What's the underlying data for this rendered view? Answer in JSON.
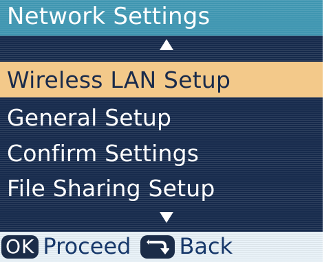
{
  "title": "Network Settings",
  "menu": {
    "items": [
      {
        "label": "Wireless LAN Setup",
        "selected": true
      },
      {
        "label": "General Setup",
        "selected": false
      },
      {
        "label": "Confirm Settings",
        "selected": false
      },
      {
        "label": "File Sharing Setup",
        "selected": false
      }
    ],
    "scroll_up_icon": "triangle-up-icon",
    "scroll_down_icon": "triangle-down-icon"
  },
  "footer": {
    "ok_badge": "OK",
    "proceed_label": "Proceed",
    "back_icon": "return-arrow-icon",
    "back_label": "Back"
  },
  "colors": {
    "title_bar": "#3f96b1",
    "menu_background": "#162a4c",
    "selected_row": "#f3c98a",
    "footer_background": "#e9f2f8",
    "footer_text": "#17386a"
  }
}
